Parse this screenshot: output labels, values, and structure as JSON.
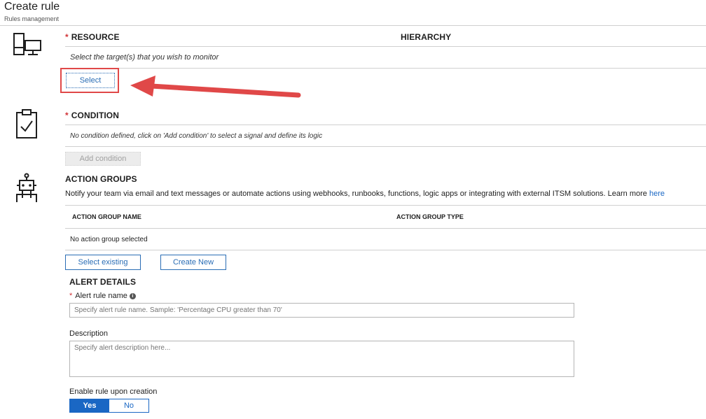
{
  "header": {
    "title": "Create rule",
    "subtitle": "Rules management"
  },
  "resource": {
    "required_mark": "*",
    "label": "RESOURCE",
    "hierarchy_label": "HIERARCHY",
    "note": "Select the target(s) that you wish to monitor",
    "select_button": "Select"
  },
  "condition": {
    "required_mark": "*",
    "label": "CONDITION",
    "note": "No condition defined, click on 'Add condition' to select a signal and define its logic",
    "add_button": "Add condition"
  },
  "action_groups": {
    "label": "ACTION GROUPS",
    "description": "Notify your team via email and text messages or automate actions using webhooks, runbooks, functions, logic apps or integrating with external ITSM solutions. Learn more ",
    "learn_more_link": "here",
    "columns": [
      "ACTION GROUP NAME",
      "ACTION GROUP TYPE"
    ],
    "empty_text": "No action group selected",
    "select_existing_button": "Select existing",
    "create_new_button": "Create New"
  },
  "alert_details": {
    "label": "ALERT DETAILS",
    "name_required_mark": "*",
    "name_label": "Alert rule name",
    "name_info_icon": "i",
    "name_placeholder": "Specify alert rule name. Sample: 'Percentage CPU greater than 70'",
    "description_label": "Description",
    "description_placeholder": "Specify alert description here...",
    "enable_label": "Enable rule upon creation",
    "enable_yes": "Yes",
    "enable_no": "No",
    "enable_selected": "Yes"
  },
  "annotation": {
    "arrow_color": "#e04848",
    "highlight_color": "#e04848"
  },
  "colors": {
    "accent": "#1a67c4",
    "required": "#d13438"
  }
}
